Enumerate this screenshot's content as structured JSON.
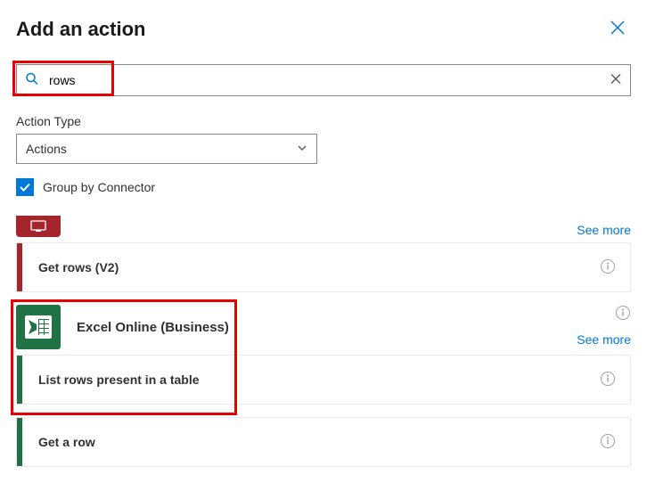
{
  "header": {
    "title": "Add an action"
  },
  "search": {
    "value": "rows"
  },
  "actionType": {
    "label": "Action Type",
    "value": "Actions"
  },
  "groupBy": {
    "label": "Group by Connector",
    "checked": true
  },
  "links": {
    "seeMore": "See more"
  },
  "group1": {
    "seeMore": "See more",
    "action1": "Get rows (V2)"
  },
  "group2": {
    "connectorName": "Excel Online (Business)",
    "seeMore": "See more",
    "action1": "List rows present in a table",
    "action2": "Get a row"
  }
}
